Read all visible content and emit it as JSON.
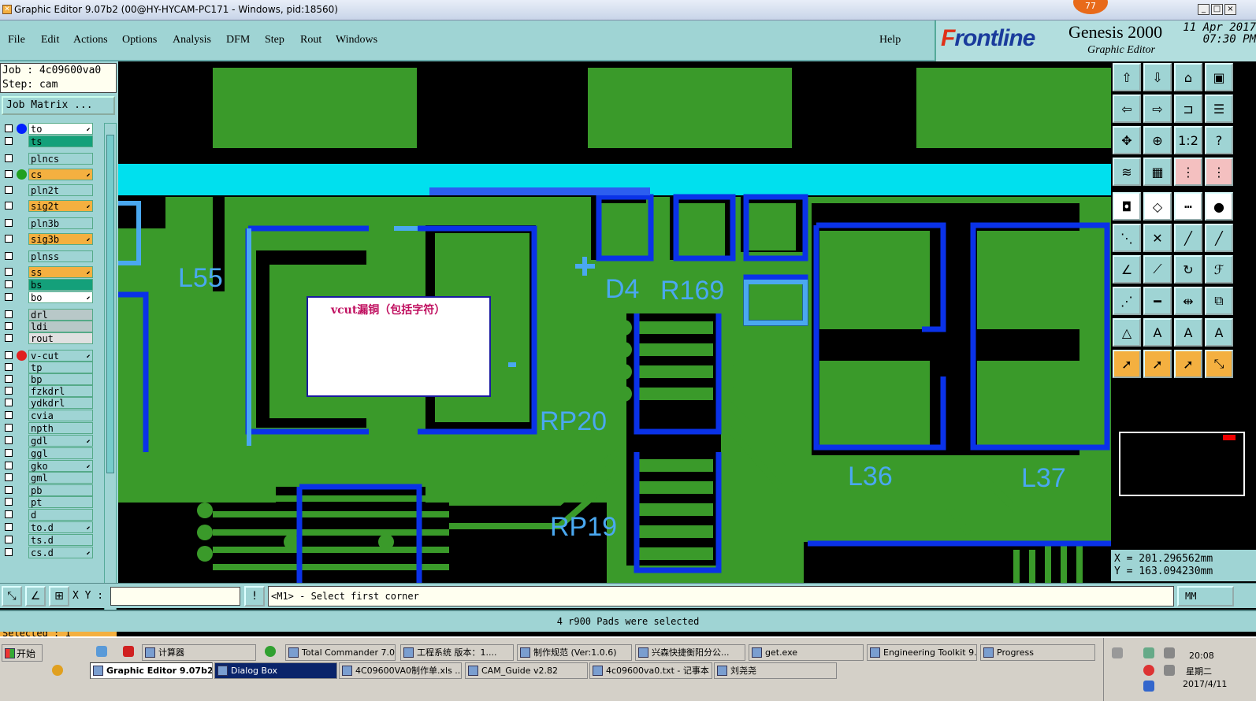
{
  "window": {
    "title": "Graphic Editor 9.07b2 (00@HY-HYCAM-PC171 - Windows, pid:18560)",
    "notification_count": "77",
    "buttons": [
      "_",
      "□",
      "×"
    ]
  },
  "menu": {
    "items": [
      "File",
      "Edit",
      "Actions",
      "Options",
      "Analysis",
      "DFM",
      "Step",
      "Rout",
      "Windows"
    ],
    "help": "Help"
  },
  "brand": {
    "logo_f": "F",
    "logo_rest": "rontline",
    "product": "Genesis 2000",
    "subtitle": "Graphic Editor",
    "date": "11 Apr 2017",
    "time": "07:30 PM"
  },
  "job": {
    "job_line": "Job : 4c09600va0",
    "step_line": "Step: cam",
    "job_matrix_label": "Job Matrix ..."
  },
  "layers": [
    {
      "name": "to",
      "color": "#ffffff",
      "dot": "#0020ff",
      "arrow": true
    },
    {
      "name": "ts",
      "color": "#14a07a",
      "dot": "",
      "arrow": false
    },
    {
      "name": "plncs",
      "color": "#9fd4d4",
      "dot": "",
      "arrow": false
    },
    {
      "name": "cs",
      "color": "#f4b040",
      "dot": "#20a020",
      "arrow": true
    },
    {
      "name": "pln2t",
      "color": "#9fd4d4",
      "dot": "",
      "arrow": false
    },
    {
      "name": "sig2t",
      "color": "#f4b040",
      "dot": "",
      "arrow": true
    },
    {
      "name": "pln3b",
      "color": "#9fd4d4",
      "dot": "",
      "arrow": false
    },
    {
      "name": "sig3b",
      "color": "#f4b040",
      "dot": "",
      "arrow": true
    },
    {
      "name": "plnss",
      "color": "#9fd4d4",
      "dot": "",
      "arrow": false
    },
    {
      "name": "ss",
      "color": "#f4b040",
      "dot": "",
      "arrow": true
    },
    {
      "name": "bs",
      "color": "#14a07a",
      "dot": "",
      "arrow": false
    },
    {
      "name": "bo",
      "color": "#ffffff",
      "dot": "",
      "arrow": true
    },
    {
      "name": "drl",
      "color": "#b8c8c8",
      "dot": "",
      "arrow": false
    },
    {
      "name": "ldi",
      "color": "#b8c8c8",
      "dot": "",
      "arrow": false
    },
    {
      "name": "rout",
      "color": "#e0e0e0",
      "dot": "",
      "arrow": false
    },
    {
      "name": "v-cut",
      "color": "#9fd4d4",
      "dot": "#e02020",
      "arrow": true
    },
    {
      "name": "tp",
      "color": "#9fd4d4",
      "dot": "",
      "arrow": false
    },
    {
      "name": "bp",
      "color": "#9fd4d4",
      "dot": "",
      "arrow": false
    },
    {
      "name": "fzkdrl",
      "color": "#9fd4d4",
      "dot": "",
      "arrow": false
    },
    {
      "name": "ydkdrl",
      "color": "#9fd4d4",
      "dot": "",
      "arrow": false
    },
    {
      "name": "cvia",
      "color": "#9fd4d4",
      "dot": "",
      "arrow": false
    },
    {
      "name": "npth",
      "color": "#9fd4d4",
      "dot": "",
      "arrow": false
    },
    {
      "name": "gdl",
      "color": "#9fd4d4",
      "dot": "",
      "arrow": true
    },
    {
      "name": "ggl",
      "color": "#9fd4d4",
      "dot": "",
      "arrow": false
    },
    {
      "name": "gko",
      "color": "#9fd4d4",
      "dot": "",
      "arrow": true
    },
    {
      "name": "gml",
      "color": "#9fd4d4",
      "dot": "",
      "arrow": false
    },
    {
      "name": "pb",
      "color": "#9fd4d4",
      "dot": "",
      "arrow": false
    },
    {
      "name": "pt",
      "color": "#9fd4d4",
      "dot": "",
      "arrow": false
    },
    {
      "name": "d",
      "color": "#9fd4d4",
      "dot": "",
      "arrow": false
    },
    {
      "name": "to.d",
      "color": "#9fd4d4",
      "dot": "",
      "arrow": true
    },
    {
      "name": "ts.d",
      "color": "#9fd4d4",
      "dot": "",
      "arrow": false
    },
    {
      "name": "cs.d",
      "color": "#9fd4d4",
      "dot": "",
      "arrow": true
    }
  ],
  "selected_label": "Selected : 1",
  "canvas": {
    "note_text": "vcut漏铜（包括字符）",
    "silk_labels": [
      "L55",
      "D4",
      "R169",
      "RP20",
      "RP19",
      "L36",
      "L37"
    ]
  },
  "coords": {
    "x": "X = 201.296562mm",
    "y": "Y = 163.094230mm"
  },
  "command": {
    "xy_label": "X Y :",
    "xy_value": "",
    "prompt": "<M1> - Select first corner",
    "units": "MM"
  },
  "status": "4 r900 Pads were selected",
  "taskbar": {
    "start": "开始",
    "row1": [
      "计算器",
      "Total Commander 7.0 ...",
      "工程系统  版本：1....",
      "制作规范 (Ver:1.0.6)",
      "兴森快捷衡阳分公...",
      "get.exe",
      "Engineering Toolkit 9....",
      "Progress"
    ],
    "row2": [
      "Graphic Editor 9.07b2 ...",
      "Dialog Box",
      "4C09600VA0制作单.xls ...",
      "CAM_Guide v2.82",
      "4c09600va0.txt - 记事本",
      "刘尧尧"
    ],
    "clock_time": "20:08",
    "clock_day": "星期二",
    "clock_date": "2017/4/11"
  }
}
